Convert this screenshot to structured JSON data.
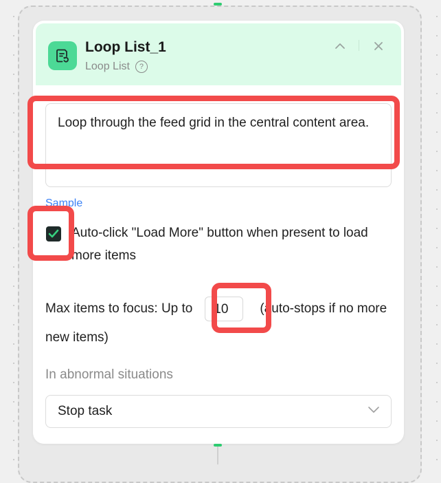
{
  "node": {
    "title": "Loop List_1",
    "subtitle": "Loop List",
    "icon": "loop-list-icon",
    "help_icon": "?"
  },
  "description": {
    "text": "Loop through the feed grid in the central content area."
  },
  "sample_link": "Sample",
  "auto_click": {
    "checked": true,
    "label": "Auto-click \"Load More\" button when present to load more items"
  },
  "max_items": {
    "prefix": "Max items to focus: Up to",
    "value": "10",
    "suffix": "(auto-stops if no more new items)"
  },
  "abnormal": {
    "label": "In abnormal situations",
    "selected": "Stop task"
  },
  "colors": {
    "header_bg": "#dcfbe9",
    "icon_bg": "#4cd996",
    "highlight": "#f24a4a",
    "link": "#3b82f6",
    "connector": "#2ecc71"
  }
}
